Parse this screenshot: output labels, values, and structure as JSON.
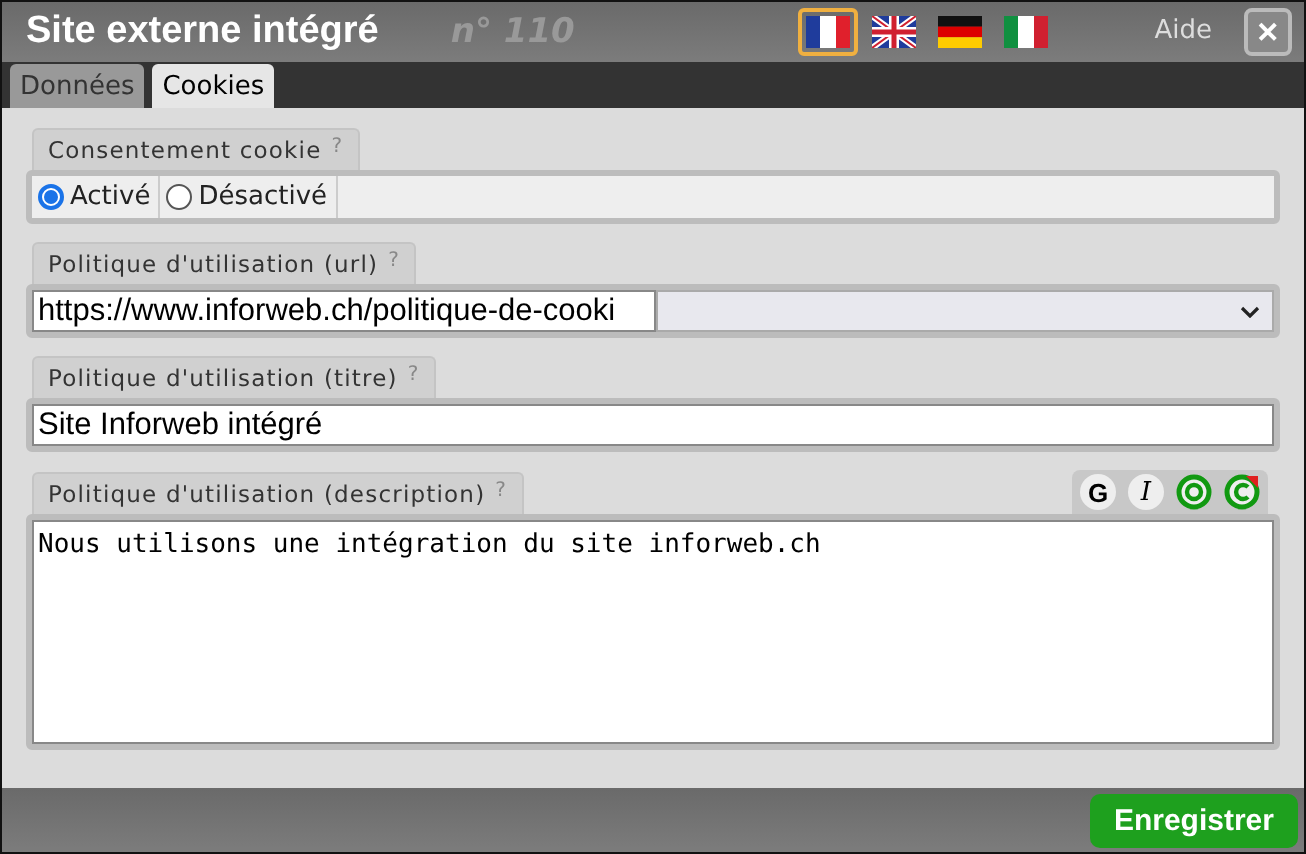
{
  "window": {
    "title": "Site externe intégré",
    "number": "n° 110",
    "help": "Aide",
    "close": "✕"
  },
  "languages": [
    {
      "kind": "fr",
      "selected": true
    },
    {
      "kind": "gb",
      "selected": false
    },
    {
      "kind": "de",
      "selected": false
    },
    {
      "kind": "it",
      "selected": false
    }
  ],
  "tabs": [
    {
      "label": "Données",
      "selected": false
    },
    {
      "label": "Cookies",
      "selected": true
    }
  ],
  "consent": {
    "label": "Consentement cookie",
    "help": "?",
    "options": [
      {
        "label": "Activé",
        "selected": true
      },
      {
        "label": "Désactivé",
        "selected": false
      }
    ]
  },
  "url": {
    "label": "Politique d'utilisation (url)",
    "help": "?",
    "value": "https://www.inforweb.ch/politique-de-cooki"
  },
  "title_field": {
    "label": "Politique d'utilisation (titre)",
    "help": "?",
    "value": "Site Inforweb intégré"
  },
  "description": {
    "label": "Politique d'utilisation (description)",
    "help": "?",
    "toolbar": [
      {
        "kind": "bold",
        "label": "G"
      },
      {
        "kind": "italic",
        "label": "I"
      },
      {
        "kind": "ring"
      },
      {
        "kind": "undo"
      }
    ],
    "value": "Nous utilisons une intégration du site inforweb.ch"
  },
  "save": "Enregistrer"
}
